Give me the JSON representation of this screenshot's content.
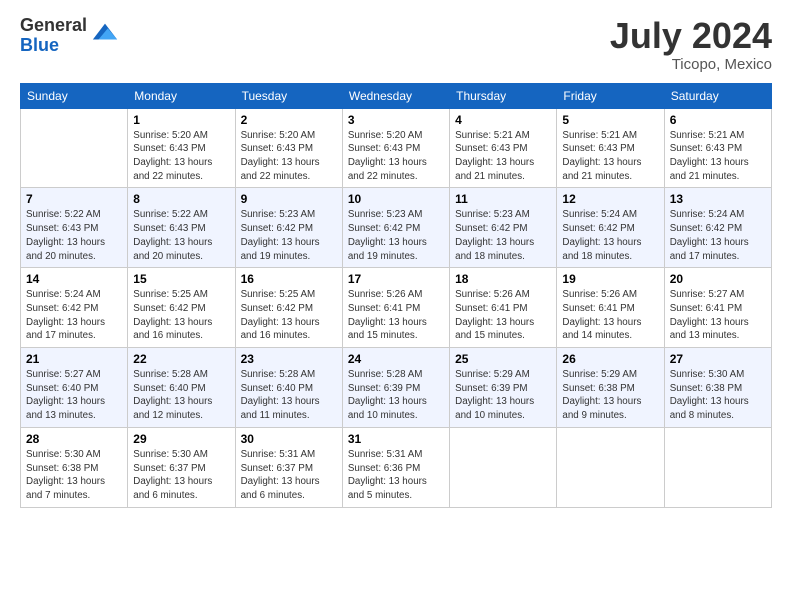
{
  "header": {
    "logo_general": "General",
    "logo_blue": "Blue",
    "month_title": "July 2024",
    "location": "Ticopo, Mexico"
  },
  "days_of_week": [
    "Sunday",
    "Monday",
    "Tuesday",
    "Wednesday",
    "Thursday",
    "Friday",
    "Saturday"
  ],
  "weeks": [
    [
      {
        "day": "",
        "info": ""
      },
      {
        "day": "1",
        "info": "Sunrise: 5:20 AM\nSunset: 6:43 PM\nDaylight: 13 hours\nand 22 minutes."
      },
      {
        "day": "2",
        "info": "Sunrise: 5:20 AM\nSunset: 6:43 PM\nDaylight: 13 hours\nand 22 minutes."
      },
      {
        "day": "3",
        "info": "Sunrise: 5:20 AM\nSunset: 6:43 PM\nDaylight: 13 hours\nand 22 minutes."
      },
      {
        "day": "4",
        "info": "Sunrise: 5:21 AM\nSunset: 6:43 PM\nDaylight: 13 hours\nand 21 minutes."
      },
      {
        "day": "5",
        "info": "Sunrise: 5:21 AM\nSunset: 6:43 PM\nDaylight: 13 hours\nand 21 minutes."
      },
      {
        "day": "6",
        "info": "Sunrise: 5:21 AM\nSunset: 6:43 PM\nDaylight: 13 hours\nand 21 minutes."
      }
    ],
    [
      {
        "day": "7",
        "info": "Sunrise: 5:22 AM\nSunset: 6:43 PM\nDaylight: 13 hours\nand 20 minutes."
      },
      {
        "day": "8",
        "info": "Sunrise: 5:22 AM\nSunset: 6:43 PM\nDaylight: 13 hours\nand 20 minutes."
      },
      {
        "day": "9",
        "info": "Sunrise: 5:23 AM\nSunset: 6:42 PM\nDaylight: 13 hours\nand 19 minutes."
      },
      {
        "day": "10",
        "info": "Sunrise: 5:23 AM\nSunset: 6:42 PM\nDaylight: 13 hours\nand 19 minutes."
      },
      {
        "day": "11",
        "info": "Sunrise: 5:23 AM\nSunset: 6:42 PM\nDaylight: 13 hours\nand 18 minutes."
      },
      {
        "day": "12",
        "info": "Sunrise: 5:24 AM\nSunset: 6:42 PM\nDaylight: 13 hours\nand 18 minutes."
      },
      {
        "day": "13",
        "info": "Sunrise: 5:24 AM\nSunset: 6:42 PM\nDaylight: 13 hours\nand 17 minutes."
      }
    ],
    [
      {
        "day": "14",
        "info": "Sunrise: 5:24 AM\nSunset: 6:42 PM\nDaylight: 13 hours\nand 17 minutes."
      },
      {
        "day": "15",
        "info": "Sunrise: 5:25 AM\nSunset: 6:42 PM\nDaylight: 13 hours\nand 16 minutes."
      },
      {
        "day": "16",
        "info": "Sunrise: 5:25 AM\nSunset: 6:42 PM\nDaylight: 13 hours\nand 16 minutes."
      },
      {
        "day": "17",
        "info": "Sunrise: 5:26 AM\nSunset: 6:41 PM\nDaylight: 13 hours\nand 15 minutes."
      },
      {
        "day": "18",
        "info": "Sunrise: 5:26 AM\nSunset: 6:41 PM\nDaylight: 13 hours\nand 15 minutes."
      },
      {
        "day": "19",
        "info": "Sunrise: 5:26 AM\nSunset: 6:41 PM\nDaylight: 13 hours\nand 14 minutes."
      },
      {
        "day": "20",
        "info": "Sunrise: 5:27 AM\nSunset: 6:41 PM\nDaylight: 13 hours\nand 13 minutes."
      }
    ],
    [
      {
        "day": "21",
        "info": "Sunrise: 5:27 AM\nSunset: 6:40 PM\nDaylight: 13 hours\nand 13 minutes."
      },
      {
        "day": "22",
        "info": "Sunrise: 5:28 AM\nSunset: 6:40 PM\nDaylight: 13 hours\nand 12 minutes."
      },
      {
        "day": "23",
        "info": "Sunrise: 5:28 AM\nSunset: 6:40 PM\nDaylight: 13 hours\nand 11 minutes."
      },
      {
        "day": "24",
        "info": "Sunrise: 5:28 AM\nSunset: 6:39 PM\nDaylight: 13 hours\nand 10 minutes."
      },
      {
        "day": "25",
        "info": "Sunrise: 5:29 AM\nSunset: 6:39 PM\nDaylight: 13 hours\nand 10 minutes."
      },
      {
        "day": "26",
        "info": "Sunrise: 5:29 AM\nSunset: 6:38 PM\nDaylight: 13 hours\nand 9 minutes."
      },
      {
        "day": "27",
        "info": "Sunrise: 5:30 AM\nSunset: 6:38 PM\nDaylight: 13 hours\nand 8 minutes."
      }
    ],
    [
      {
        "day": "28",
        "info": "Sunrise: 5:30 AM\nSunset: 6:38 PM\nDaylight: 13 hours\nand 7 minutes."
      },
      {
        "day": "29",
        "info": "Sunrise: 5:30 AM\nSunset: 6:37 PM\nDaylight: 13 hours\nand 6 minutes."
      },
      {
        "day": "30",
        "info": "Sunrise: 5:31 AM\nSunset: 6:37 PM\nDaylight: 13 hours\nand 6 minutes."
      },
      {
        "day": "31",
        "info": "Sunrise: 5:31 AM\nSunset: 6:36 PM\nDaylight: 13 hours\nand 5 minutes."
      },
      {
        "day": "",
        "info": ""
      },
      {
        "day": "",
        "info": ""
      },
      {
        "day": "",
        "info": ""
      }
    ]
  ]
}
